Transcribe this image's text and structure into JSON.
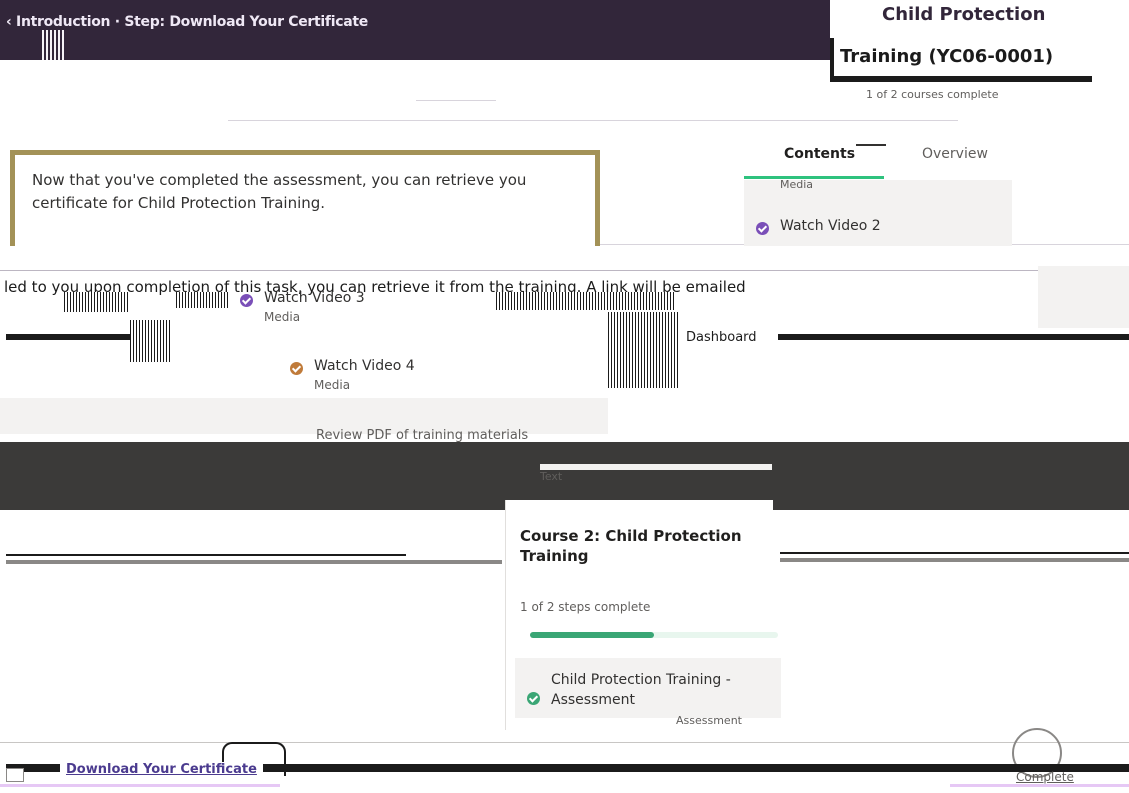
{
  "header": {
    "breadcrumb": "‹ Introduction · Step: Download Your Certificate",
    "breadcrumb_link": "Download Your Certificate"
  },
  "training": {
    "title_fragment": "Child Protection",
    "title": "Training (YC06-0001)",
    "progress": "1 of 2 courses complete"
  },
  "message": {
    "text": "Now that you've completed the assessment, you can retrieve you certificate for Child Protection Training."
  },
  "tabs": {
    "contents": "Contents",
    "overview": "Overview"
  },
  "steps": [
    {
      "name": "Watch Video 2",
      "type": "Media",
      "color": "#7a4fb8"
    },
    {
      "name": "Watch Video 3",
      "type": "Media",
      "color": "#7a4fb8"
    },
    {
      "name": "Watch Video 4",
      "type": "Media",
      "color": "#c07b3a"
    }
  ],
  "clipped_media": "Media",
  "body": {
    "glitch_line": "led to you upon completion of this task, you can retrieve it from the training. A link will be emailed",
    "dashboard_label": "Dashboard",
    "review": "Review PDF of training materials",
    "text_label": "Text"
  },
  "course": {
    "title": "Course 2: Child Protection Training",
    "steps_complete": "1 of 2 steps complete",
    "progress_fraction": 0.5
  },
  "assessment": {
    "name": "Child Protection Training - Assessment",
    "type": "Assessment",
    "color": "#3aa675"
  },
  "footer": {
    "download_button": "Download Your Certificate",
    "complete_link": "Complete"
  }
}
